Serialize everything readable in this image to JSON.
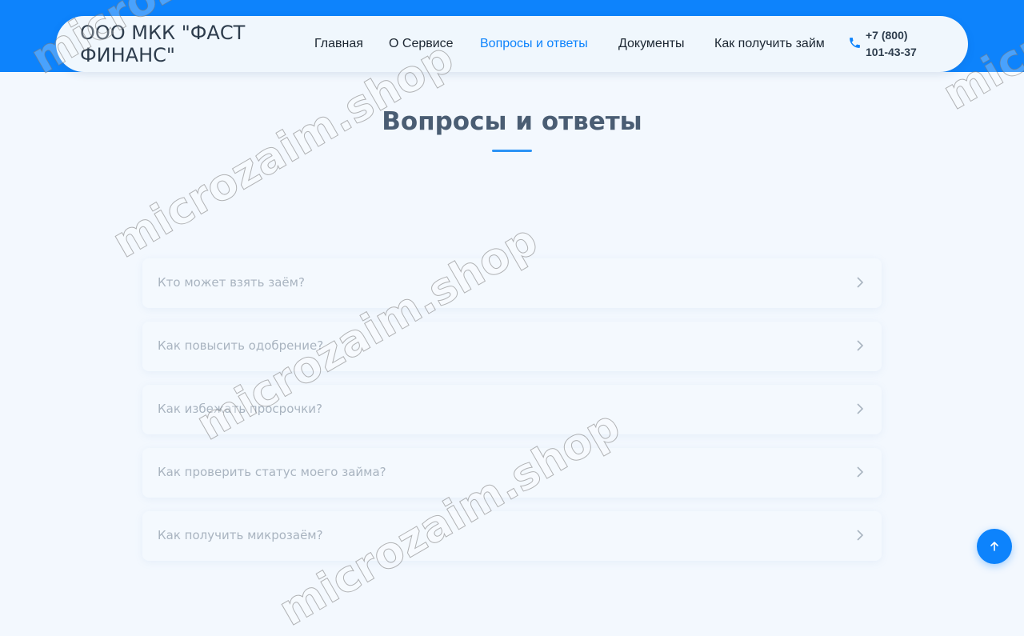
{
  "header": {
    "company_name": "ООО МКК \"ФАСТ ФИНАНС\"",
    "nav": [
      {
        "label": "Главная",
        "active": false
      },
      {
        "label": "О Сервисе",
        "active": false
      },
      {
        "label": "Вопросы и ответы",
        "active": true
      },
      {
        "label": "Документы",
        "active": false
      },
      {
        "label": "Как получить займ",
        "active": false
      }
    ],
    "phone": "+7 (800) 101-43-37",
    "phone_icon": "phone-icon"
  },
  "page": {
    "title": "Вопросы и ответы"
  },
  "faq": [
    {
      "question": "Кто может взять заём?"
    },
    {
      "question": "Как повысить одобрение?"
    },
    {
      "question": "Как избежать просрочки?"
    },
    {
      "question": "Как проверить статус моего займа?"
    },
    {
      "question": "Как получить микрозаём?"
    }
  ],
  "watermark": "microzaim.shop",
  "colors": {
    "brand": "#0d83fc",
    "active_nav": "#0d83fc",
    "background": "#f3f8fe",
    "title": "#4a5d73"
  }
}
